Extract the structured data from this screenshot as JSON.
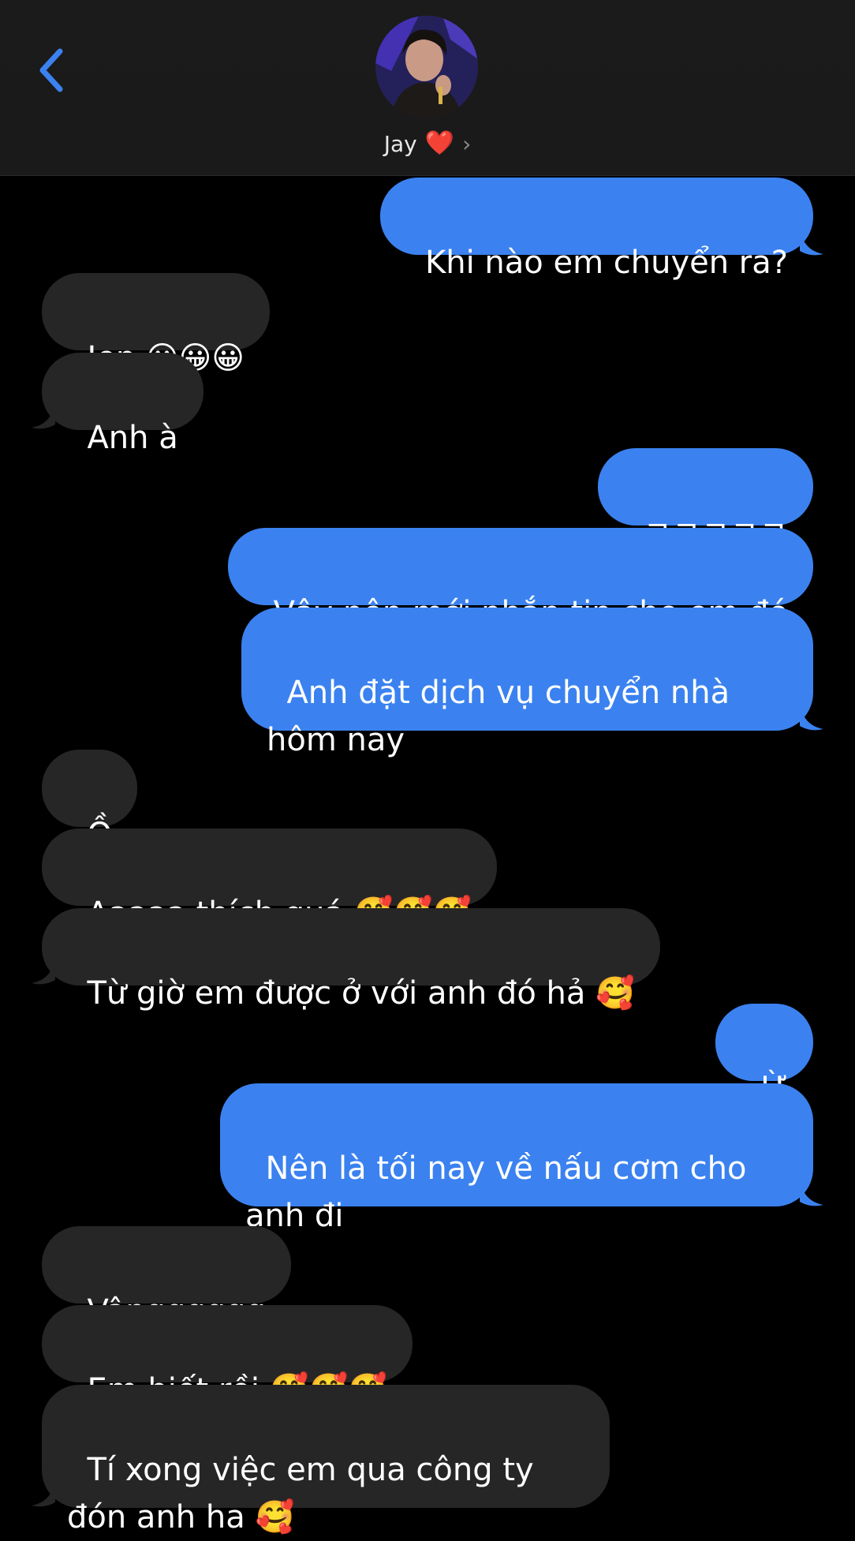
{
  "header": {
    "back_icon": "chevron-left-icon",
    "contact_name": "Jay",
    "contact_heart": "❤️",
    "contact_chevron": "›",
    "colors": {
      "accent": "#3b82f0",
      "back": "#3b82f0"
    }
  },
  "messages": [
    {
      "side": "out",
      "text": "Khi nào em chuyển ra?"
    },
    {
      "side": "in",
      "text": "Jen 😀😀😀"
    },
    {
      "side": "in",
      "text": "Anh à"
    },
    {
      "side": "out",
      "text": "ㅋㅋㅋㅋㅋ"
    },
    {
      "side": "out",
      "text": "Vậy nên mới nhắn tin cho em đó"
    },
    {
      "side": "out",
      "text": "Anh đặt dịch vụ chuyển nhà hôm nay"
    },
    {
      "side": "in",
      "text": "Ồ"
    },
    {
      "side": "in",
      "text": "Aaaaa thích quá 🥰🥰🥰"
    },
    {
      "side": "in",
      "text": "Từ giờ em được ở với anh đó hả 🥰"
    },
    {
      "side": "out",
      "text": "Ừ"
    },
    {
      "side": "out",
      "text": "Nên là tối nay về nấu cơm cho anh đi"
    },
    {
      "side": "in",
      "text": "Vângggggg"
    },
    {
      "side": "in",
      "text": "Em biết rồi 🥰🥰🥰"
    },
    {
      "side": "in",
      "text": "Tí xong việc em qua công ty đón anh ha 🥰"
    }
  ]
}
